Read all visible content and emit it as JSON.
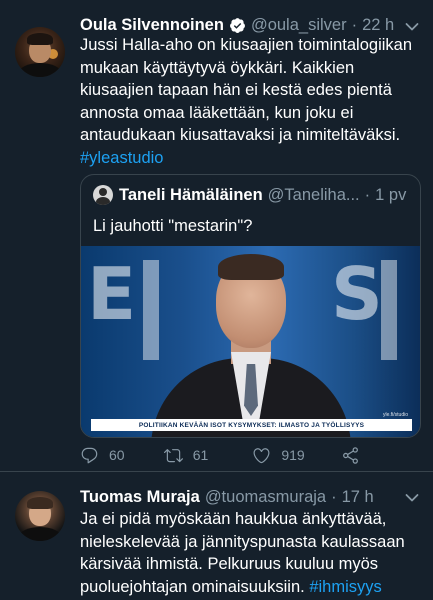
{
  "tweets": [
    {
      "author": "Oula Silvennoinen",
      "verified": true,
      "handle": "@oula_silver",
      "time": "22 h",
      "text_parts": [
        "Jussi Halla-aho on kiusaajien toimintalogiikan mukaan käyttäytyvä öykkäri. Kaikkien kiusaajien tapaan hän ei kestä edes pientä annosta omaa lääkettään, kun joku ei antaudukaan kiusattavaksi ja nimiteltäväksi.",
        "#yleastudio"
      ],
      "quote": {
        "author": "Taneli Hämäläinen",
        "handle": "@Taneliha...",
        "time": "1 pv",
        "text": "Li jauhotti \"mestarin\"?",
        "media_ticker": "POLITIIKAN KEVÄÄN ISOT KYSYMYKSET: ILMASTO JA TYÖLLISYYS",
        "media_corner": "yle.fi/studio"
      },
      "actions": {
        "replies": "60",
        "retweets": "61",
        "likes": "919"
      }
    },
    {
      "author": "Tuomas Muraja",
      "handle": "@tuomasmuraja",
      "time": "17 h",
      "text_parts": [
        "Ja ei pidä myöskään haukkua änkyttävää, nieleskelevää ja jännityspunasta kaulassaan kärsivää ihmistä. Pelkuruus kuuluu myös puoluejohtajan ominaisuuksiin.",
        "#ihmisyys"
      ]
    }
  ],
  "colors": {
    "background": "#15202b",
    "text": "#ffffff",
    "muted": "#8899a6",
    "link": "#1da1f2",
    "border": "#38444d"
  },
  "icons": [
    "verified-badge-icon",
    "chevron-down-icon",
    "reply-icon",
    "retweet-icon",
    "like-icon",
    "share-icon"
  ]
}
